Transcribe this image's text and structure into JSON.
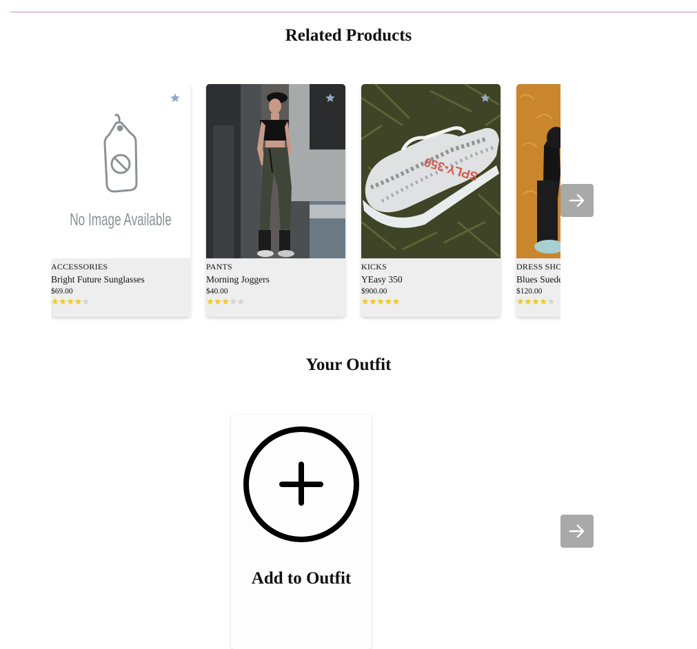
{
  "related": {
    "title": "Related Products",
    "products": [
      {
        "category": "ACCESSORIES",
        "name": "Bright Future Sunglasses",
        "price": "$69.00",
        "rating": 4,
        "image": "placeholder"
      },
      {
        "category": "PANTS",
        "name": "Morning Joggers",
        "price": "$40.00",
        "rating": 3,
        "image": "photo"
      },
      {
        "category": "KICKS",
        "name": "YEasy 350",
        "price": "$900.00",
        "rating": 5,
        "image": "photo"
      },
      {
        "category": "DRESS SHOES",
        "name": "Blues Suede Shoes",
        "price": "$120.00",
        "rating": 4,
        "image": "photo"
      }
    ],
    "placeholder_text": "No Image Available",
    "sneaker_print": "SPLY-350"
  },
  "outfit": {
    "title": "Your Outfit",
    "add_label": "Add to Outfit"
  },
  "icons": {
    "favorite": "star-icon",
    "next": "arrow-right-icon",
    "add": "plus-circle-icon"
  },
  "colors": {
    "divider": "#c98fcf",
    "card_bg": "#eeeeee",
    "star_filled": "#f6c913",
    "star_empty": "#d3d3d3",
    "favorite_star": "#94a9c2",
    "arrow_button": "#a9a9a9"
  }
}
